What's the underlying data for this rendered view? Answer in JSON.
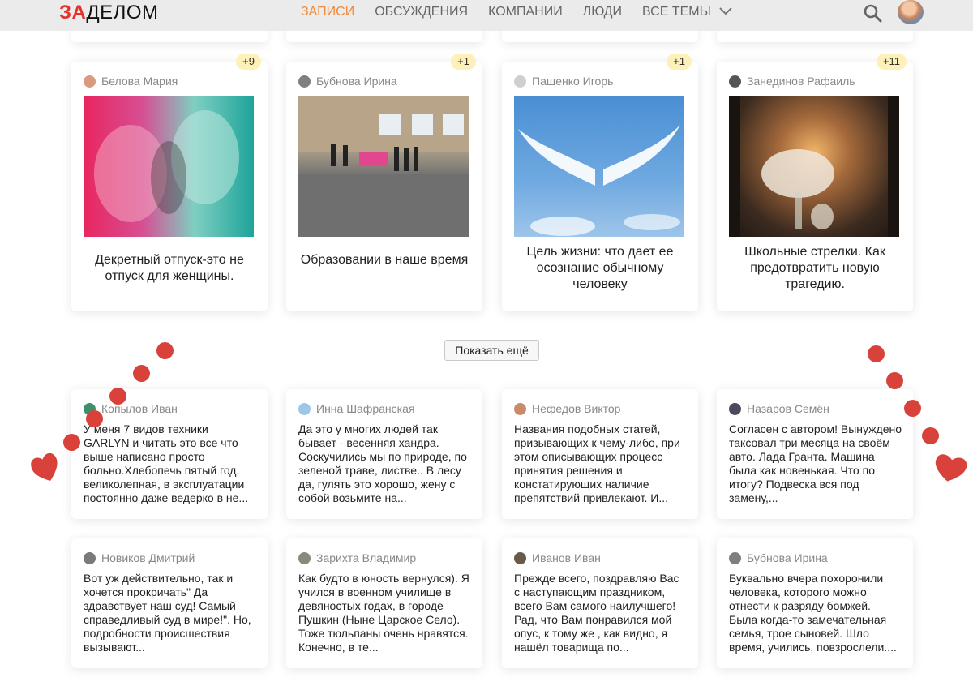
{
  "header": {
    "logo_accent": "ЗА",
    "logo_rest": "ДЕЛОМ",
    "nav": [
      {
        "label": "Записи",
        "active": true
      },
      {
        "label": "Обсуждения",
        "active": false
      },
      {
        "label": "Компании",
        "active": false
      },
      {
        "label": "Люди",
        "active": false
      },
      {
        "label": "Все темы",
        "active": false
      }
    ]
  },
  "articles": [
    {
      "author": "Белова Мария",
      "badge": "+9",
      "title": "Декретный отпуск-это не отпуск для женщины."
    },
    {
      "author": "Бубнова Ирина",
      "badge": "+1",
      "title": "Образовании в наше время"
    },
    {
      "author": "Пащенко Игорь",
      "badge": "+1",
      "title": "Цель жизни: что дает ее осознание обычному человеку"
    },
    {
      "author": "Занединов Рафаиль",
      "badge": "+11",
      "title": "Школьные стрелки. Как предотвратить новую трагедию."
    }
  ],
  "show_more_label": "Показать ещё",
  "comments": [
    {
      "author": "Копылов Иван",
      "text": "У меня 7 видов техники GARLYN и читать это все что выше написано просто больно.Хлебопечь пятый год, великолепная, в эксплуатации постоянно даже ведерко в не..."
    },
    {
      "author": "Инна Шафранская",
      "text": "Да это у многих людей так бывает - весенняя хандра. Соскучились мы по природе, по зеленой траве, листве.. В лесу да, гулять это хорошо, жену с собой возьмите на..."
    },
    {
      "author": "Нефедов Виктор",
      "text": "Названия подобных статей, призывающих к чему-либо, при этом описывающих процесс принятия решения и констатирующих наличие препятствий привлекают. И..."
    },
    {
      "author": "Назаров Семён",
      "text": "Согласен с автором! Вынуждено таксовал три месяца на своём авто. Лада Гранта. Машина была как новенькая. Что по итогу? Подвеска вся под замену,..."
    },
    {
      "author": "Новиков Дмитрий",
      "text": "Вот уж действительно, так и хочется прокричать\" Да здравствует наш суд! Самый справедливый суд в мире!\". Но, подробности происшествия вызывают..."
    },
    {
      "author": "Зарихта Владимир",
      "text": "Как будто в юность вернулся). Я учился в военном училище в девяностых годах, в городе Пушкин (Ныне Царское Село). Тоже тюльпаны очень нравятся. Конечно, в те..."
    },
    {
      "author": "Иванов Иван",
      "text": "Прежде всего, поздравляю Вас с наступающим праздником, всего Вам самого наилучшего! Рад, что Вам понравился мой опус, к тому же , как видно, я нашёл товарища по..."
    },
    {
      "author": "Бубнова Ирина",
      "text": "Буквально вчера похоронили человека, которого можно отнести к разряду бомжей. Была когда-то замечательная семья, трое сыновей. Шло время, учились, повзрослели...."
    }
  ],
  "colors": {
    "accent": "#e4312b",
    "nav_active": "#f08a3c",
    "badge": "#fdf0b8",
    "decor": "#d8423a"
  }
}
